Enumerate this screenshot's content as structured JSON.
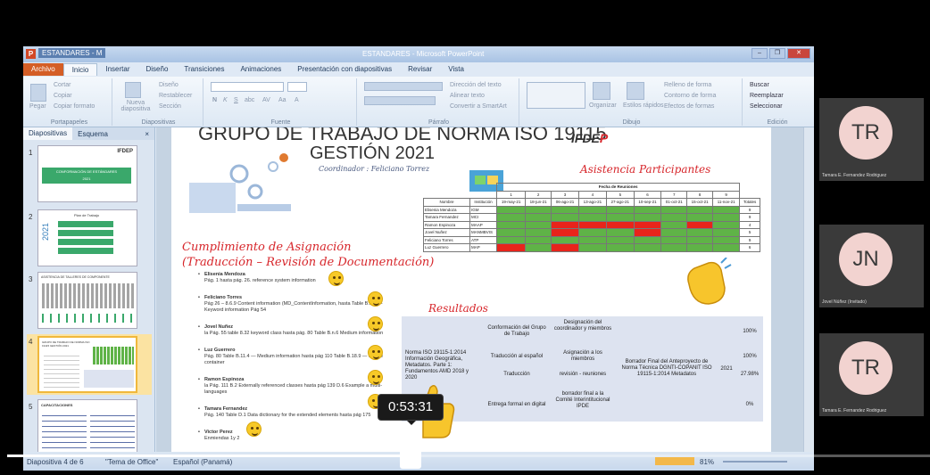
{
  "window": {
    "doc_tab": "ESTANDARES - M",
    "title": "ESTANDARES - Microsoft PowerPoint",
    "buttons": [
      "–",
      "❐",
      "✕"
    ]
  },
  "ribbon": {
    "tabs": [
      "Archivo",
      "Inicio",
      "Insertar",
      "Diseño",
      "Transiciones",
      "Animaciones",
      "Presentación con diapositivas",
      "Revisar",
      "Vista"
    ],
    "groups": {
      "portapapeles": {
        "label": "Portapapeles",
        "items": [
          "Pegar",
          "Cortar",
          "Copiar",
          "Copiar formato"
        ]
      },
      "diapositivas": {
        "label": "Diapositivas",
        "items": [
          "Nueva diapositiva",
          "Diseño",
          "Restablecer",
          "Sección"
        ]
      },
      "fuente": {
        "label": "Fuente",
        "items": [
          "N",
          "K",
          "S",
          "abc",
          "AV",
          "Aa",
          "A"
        ]
      },
      "parrafo": {
        "label": "Párrafo",
        "items": [
          "Dirección del texto",
          "Alinear texto",
          "Convertir a SmartArt"
        ]
      },
      "dibujo": {
        "label": "Dibujo",
        "items": [
          "Organizar",
          "Estilos rápidos",
          "Relleno de forma",
          "Contorno de forma",
          "Efectos de formas"
        ]
      },
      "edicion": {
        "label": "Edición",
        "items": [
          "Buscar",
          "Reemplazar",
          "Seleccionar"
        ]
      }
    }
  },
  "panel": {
    "tabs": [
      "Diapositivas",
      "Esquema"
    ],
    "close": "×",
    "slides": [
      {
        "num": "1",
        "heading": "CONFORMACIÓN DE ESTÁNDARES",
        "sub": "2021",
        "logo": "IFDEP"
      },
      {
        "num": "2",
        "heading": "Plan de Trabajo",
        "year": "2021"
      },
      {
        "num": "3",
        "heading": "ASISTENCIA DE TALLERES DE COMPONENTE"
      },
      {
        "num": "4",
        "heading": "GRUPO DE TRABAJO DE NORMA ISO 19115 GESTIÓN 2021"
      },
      {
        "num": "5",
        "heading": "CAPACITACIONES"
      }
    ]
  },
  "slide": {
    "title_line1": "GRUPO DE TRABAJO DE NORMA ISO 19115",
    "title_line2": "GESTIÓN 2021",
    "coordinator": "Coordinador : Feliciano Torrez",
    "logo": {
      "text": "IFDE",
      "accent": "P"
    },
    "attendance_heading": "Asistencia Participantes",
    "assignment_heading": [
      "Cumplimiento de Asignación",
      "(Traducción – Revisión de Documentación)"
    ],
    "results_heading": "Resultados",
    "participants": [
      {
        "name": "Elisenia Mendoza",
        "detail": "Pág. 1 hasta pág. 26. reference system information"
      },
      {
        "name": "Feliciano Torres",
        "detail": "Pág 26 – 8.6.9 Content information (MD_ContentInformation, hasta Table B.3.1 — Keyword information Pág 54"
      },
      {
        "name": "Jovel Nuñez",
        "detail": "la Pág. 55 table 8.32 keyword class hasta pág. 80 Table B.n.6 Medium information"
      },
      {
        "name": "Luz Guerrero",
        "detail": "Pág. 80 Table B.11.4 — Medium information hasta pág 110 Table B.18.9 — Locale container"
      },
      {
        "name": "Ramon Espinoza",
        "detail": "la Pág. 111 B.2 Externally referenced classes hasta pág 139 D.6 Example a multi-languages"
      },
      {
        "name": "Tamara Fernandez",
        "detail": "Pág. 140 Table D.1 Data dictionary for the extended elements hasta pág 175"
      },
      {
        "name": "Victor Perez",
        "detail": "Enmiendas 1y 2"
      }
    ],
    "attendance_table": {
      "group_header": "Fecha de Reuniones",
      "col_headers": [
        "Nombre",
        "Institución",
        "1",
        "2",
        "3",
        "4",
        "5",
        "6",
        "7",
        "8",
        "9",
        "Totales"
      ],
      "dates": [
        "19-may-21",
        "18-jun-21",
        "06-ago-21",
        "13-ago-21",
        "27-ago-21",
        "10-sep-21",
        "01-oct-21",
        "15-oct-21",
        "11-nov-21"
      ],
      "rows": [
        {
          "name": "Elisenia Mendoza",
          "inst": "IGM",
          "cells": "ggggggggg",
          "total": "9"
        },
        {
          "name": "Tamara Fernandez",
          "inst": "MCI",
          "cells": "ggggggggg",
          "total": "9"
        },
        {
          "name": "Ramon Espinoza",
          "inst": "MAAP",
          "cells": "ggrrrrgrg",
          "total": "4"
        },
        {
          "name": "Jovel Nuñez",
          "inst": "MANMBVIS",
          "cells": "ggrggrggg",
          "total": "5"
        },
        {
          "name": "Feliciano Torres",
          "inst": "ATP",
          "cells": "ggggggggg",
          "total": "9"
        },
        {
          "name": "Luz Guerrero",
          "inst": "MAP",
          "cells": "rgrgggggg",
          "total": "6"
        }
      ]
    },
    "results_table": {
      "norm": "Norma ISO 19115-1:2014 Información Geográfica, Metadatos. Parte 1: Fundamentos AMD 2018 y 2020",
      "activities": [
        "Conformación del Grupo de Trabajo",
        "Traducción al español",
        "Traducción",
        "Entrega formal en digital"
      ],
      "tasks": [
        "Designación del coordinador y miembros",
        "Asignación a los miembros",
        "revisión - reuniones",
        "borrador final a la Comité Interintitucional IPDE"
      ],
      "product": "Borrador Final del Anteproyecto de Norma Técnica DGNTI-COPANIT ISO 19115-1:2014 Metadatos",
      "year": "2021",
      "percents": [
        "100%",
        "100%",
        "27.98%",
        "0%"
      ]
    }
  },
  "statusbar": {
    "slide_info": "Diapositiva 4 de 6",
    "theme": "\"Tema de Office\"",
    "language": "Español (Panamá)",
    "zoom": "81%"
  },
  "video": {
    "time": "0:53:31",
    "progress_fraction": 0.44
  },
  "participants_video": [
    {
      "initials": "TR",
      "name": "Tamara E. Fernandez Rodriguez"
    },
    {
      "initials": "JN",
      "name": "Jovel Núñez (Invitado)"
    },
    {
      "initials": "TR",
      "name": "Tamara E. Fernandez Rodriguez"
    }
  ]
}
